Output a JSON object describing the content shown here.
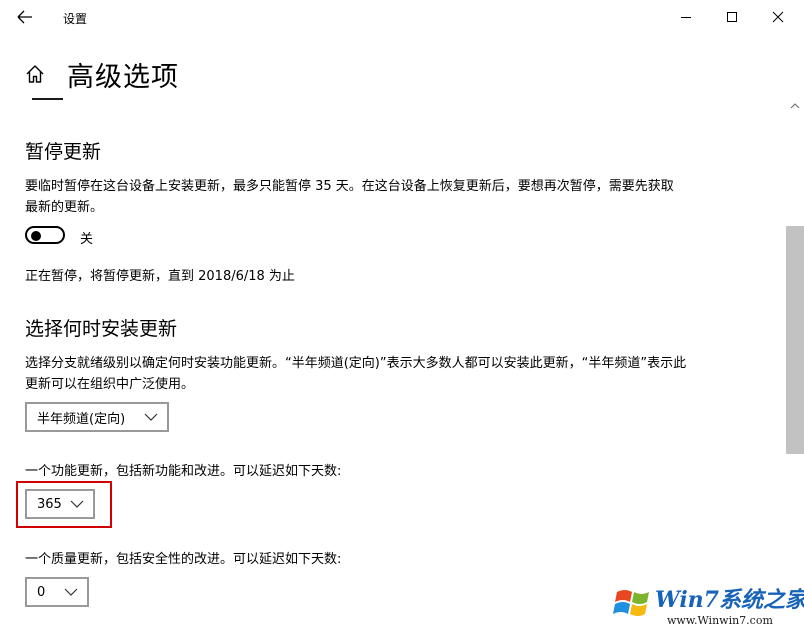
{
  "window": {
    "title": "设置"
  },
  "page": {
    "title": "高级选项"
  },
  "pause": {
    "heading": "暂停更新",
    "description_line1": "要临时暂停在这台设备上安装更新，最多只能暂停 35 天。在这台设备上恢复更新后，要想再次暂停，需要先获取",
    "description_line2": "最新的更新。",
    "toggle_state": "关",
    "status": "正在暂停，将暂停更新，直到 2018/6/18 为止"
  },
  "install": {
    "heading": "选择何时安装更新",
    "description_line1": "选择分支就绪级别以确定何时安装功能更新。“半年频道(定向)”表示大多数人都可以安装此更新，“半年频道”表示此",
    "description_line2": "更新可以在组织中广泛使用。",
    "branch_value": "半年频道(定向)",
    "feature_label": "一个功能更新，包括新功能和改进。可以延迟如下天数:",
    "feature_days": "365",
    "quality_label": "一个质量更新，包括安全性的改进。可以延迟如下天数:",
    "quality_days": "0"
  },
  "watermark": {
    "brand": "Win7系统之家",
    "url": "www.Winwin7.com"
  },
  "colors": {
    "highlight": "#d40000",
    "brand": "#1763b8",
    "scroll_thumb": "#c2c2c2"
  }
}
